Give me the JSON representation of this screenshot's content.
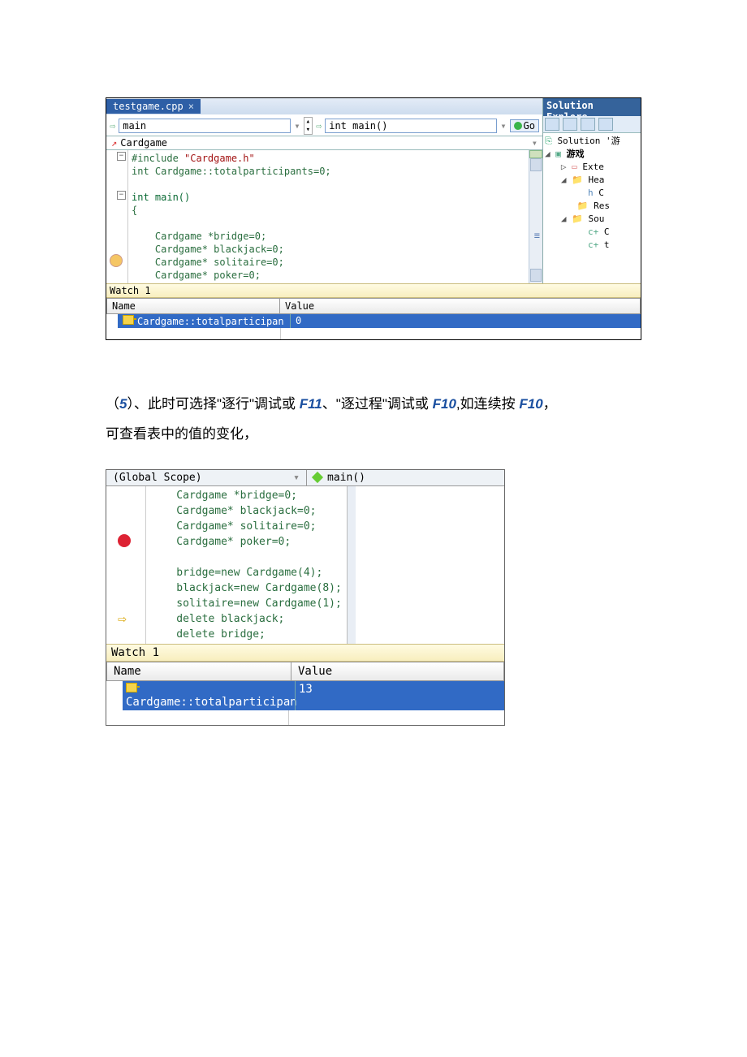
{
  "shot1": {
    "tab": "testgame.cpp",
    "nav_main": "main",
    "nav_func": "int main()",
    "go": "Go",
    "class_combo": "Cardgame",
    "code": {
      "l1a": "#include ",
      "l1b": "\"Cardgame.h\"",
      "l2": "int Cardgame::totalparticipants=0;",
      "l3": "int main()",
      "l4": "{",
      "l5": "    Cardgame *bridge=0;",
      "l6": "    Cardgame* blackjack=0;",
      "l7": "    Cardgame* solitaire=0;",
      "l8": "    Cardgame* poker=0;"
    },
    "se": {
      "title": "Solution Explore",
      "sol": "Solution '游",
      "proj": "游戏",
      "exte": "Exte",
      "hea": "Hea",
      "hc": "C",
      "res": "Res",
      "sou": "Sou",
      "c1": "C",
      "t": "t"
    },
    "watch": {
      "title": "Watch 1",
      "col_name": "Name",
      "col_value": "Value",
      "row_name": "Cardgame::totalparticipan",
      "row_value": "0"
    }
  },
  "para": {
    "t1": "（",
    "num": "5",
    "t2": "）、此时可选择\"逐行\"调试或 ",
    "k1": "F11",
    "t3": "、\"逐过程\"调试或 ",
    "k2": "F10",
    "t4": ",如连续按 ",
    "k3": "F10",
    "t5": "，",
    "line2": "可查看表中的值的变化，"
  },
  "shot2": {
    "scope": "(Global Scope)",
    "func": "main()",
    "code": {
      "l1": "    Cardgame *bridge=0;",
      "l2": "    Cardgame* blackjack=0;",
      "l3": "    Cardgame* solitaire=0;",
      "l4": "    Cardgame* poker=0;",
      "l5": "",
      "l6": "    bridge=new Cardgame(4);",
      "l7": "    blackjack=new Cardgame(8);",
      "l8": "    solitaire=new Cardgame(1);",
      "l9": "    delete blackjack;",
      "l10": "    delete bridge;"
    },
    "watch": {
      "title": "Watch 1",
      "col_name": "Name",
      "col_value": "Value",
      "row_name": "Cardgame::totalparticipan",
      "row_value": "13"
    }
  }
}
